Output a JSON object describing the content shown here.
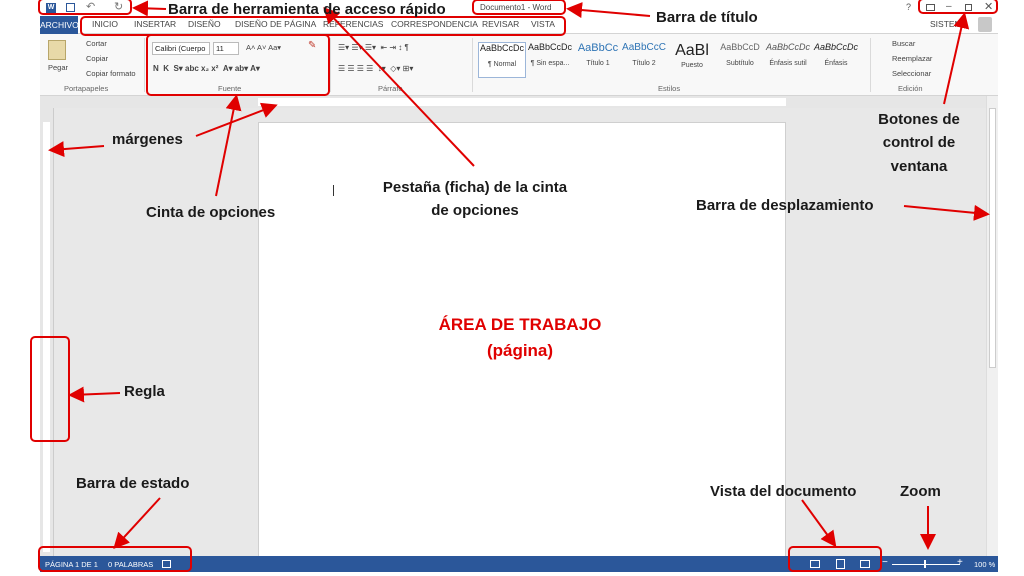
{
  "quick_access": {
    "icons": [
      "word-icon",
      "save-icon",
      "undo-icon",
      "redo-icon"
    ]
  },
  "title": {
    "document": "Documento1 - Word"
  },
  "window": {
    "help": "?",
    "user": "SISTEMA"
  },
  "tabs": {
    "archivo": "ARCHIVO",
    "items": [
      "INICIO",
      "INSERTAR",
      "DISEÑO",
      "DISEÑO DE PÁGINA",
      "REFERENCIAS",
      "CORRESPONDENCIA",
      "REVISAR",
      "VISTA"
    ]
  },
  "ribbon": {
    "paste": "Pegar",
    "cut": "Cortar",
    "copy": "Copiar",
    "format_painter": "Copiar formato",
    "font_name": "Calibri (Cuerpo",
    "font_size": "11",
    "styles": [
      {
        "preview": "AaBbCcDc",
        "name": "¶ Normal"
      },
      {
        "preview": "AaBbCcDc",
        "name": "¶ Sin espa..."
      },
      {
        "preview": "AaBbCc",
        "name": "Título 1"
      },
      {
        "preview": "AaBbCcC",
        "name": "Título 2"
      },
      {
        "preview": "AaBl",
        "name": "Puesto"
      },
      {
        "preview": "AaBbCcD",
        "name": "Subtítulo"
      },
      {
        "preview": "AaBbCcDc",
        "name": "Énfasis sutil"
      },
      {
        "preview": "AaBbCcDc",
        "name": "Énfasis"
      }
    ],
    "find": "Buscar",
    "replace": "Reemplazar",
    "select": "Seleccionar",
    "groups": [
      "Portapapeles",
      "Fuente",
      "Párrafo",
      "Estilos",
      "Edición"
    ]
  },
  "status": {
    "page": "PÁGINA 1 DE 1",
    "words": "0 PALABRAS",
    "zoom": "100 %"
  },
  "annotations": {
    "quick_access": "Barra de herramienta de acceso rápido",
    "title_bar": "Barra de título",
    "window_buttons": "Botones de control de ventana",
    "margins": "márgenes",
    "ribbon": "Cinta de opciones",
    "ribbon_tab": "Pestaña (ficha) de la cinta de opciones",
    "scrollbar": "Barra de desplazamiento",
    "work_area": "ÁREA DE TRABAJO (página)",
    "ruler": "Regla",
    "status_bar": "Barra de estado",
    "doc_view": "Vista del documento",
    "zoom": "Zoom"
  }
}
